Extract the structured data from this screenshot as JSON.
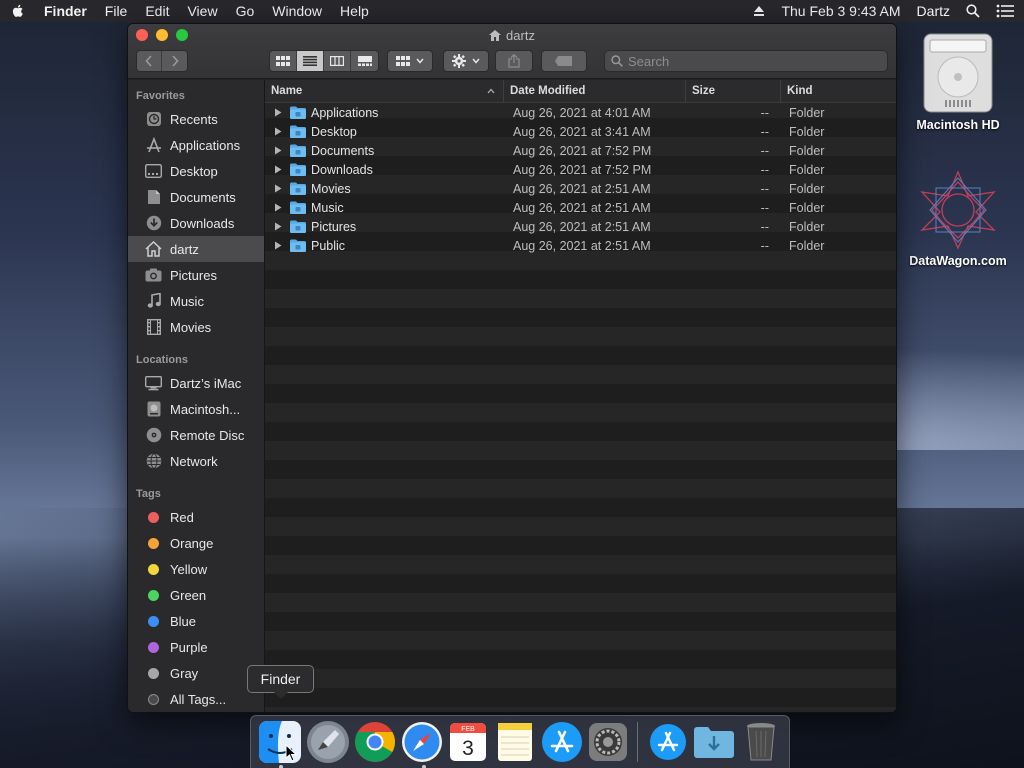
{
  "menubar": {
    "app_name": "Finder",
    "menus": [
      "File",
      "Edit",
      "View",
      "Go",
      "Window",
      "Help"
    ],
    "datetime": "Thu Feb 3  9:43 AM",
    "user": "Dartz"
  },
  "window": {
    "title": "dartz",
    "search_placeholder": "Search"
  },
  "sidebar": {
    "favorites_header": "Favorites",
    "favorites": [
      {
        "label": "Recents",
        "icon": "clock-icon"
      },
      {
        "label": "Applications",
        "icon": "applications-icon"
      },
      {
        "label": "Desktop",
        "icon": "desktop-icon"
      },
      {
        "label": "Documents",
        "icon": "document-icon"
      },
      {
        "label": "Downloads",
        "icon": "download-icon"
      },
      {
        "label": "dartz",
        "icon": "home-icon"
      },
      {
        "label": "Pictures",
        "icon": "camera-icon"
      },
      {
        "label": "Music",
        "icon": "music-note-icon"
      },
      {
        "label": "Movies",
        "icon": "film-icon"
      }
    ],
    "locations_header": "Locations",
    "locations": [
      {
        "label": "Dartz’s iMac",
        "icon": "monitor-icon"
      },
      {
        "label": "Macintosh...",
        "icon": "hard-disk-icon"
      },
      {
        "label": "Remote Disc",
        "icon": "disc-icon"
      },
      {
        "label": "Network",
        "icon": "globe-icon"
      }
    ],
    "tags_header": "Tags",
    "tags": [
      {
        "label": "Red",
        "color": "#ec5f5f"
      },
      {
        "label": "Orange",
        "color": "#f5a33a"
      },
      {
        "label": "Yellow",
        "color": "#f3d53c"
      },
      {
        "label": "Green",
        "color": "#4cd461"
      },
      {
        "label": "Blue",
        "color": "#3a8ef5"
      },
      {
        "label": "Purple",
        "color": "#b163e0"
      },
      {
        "label": "Gray",
        "color": "#a7a7a7"
      }
    ],
    "all_tags": "All Tags..."
  },
  "columns": {
    "name": "Name",
    "date": "Date Modified",
    "size": "Size",
    "kind": "Kind"
  },
  "files": [
    {
      "name": "Applications",
      "date": "Aug 26, 2021 at 4:01 AM",
      "size": "--",
      "kind": "Folder"
    },
    {
      "name": "Desktop",
      "date": "Aug 26, 2021 at 3:41 AM",
      "size": "--",
      "kind": "Folder"
    },
    {
      "name": "Documents",
      "date": "Aug 26, 2021 at 7:52 PM",
      "size": "--",
      "kind": "Folder"
    },
    {
      "name": "Downloads",
      "date": "Aug 26, 2021 at 7:52 PM",
      "size": "--",
      "kind": "Folder"
    },
    {
      "name": "Movies",
      "date": "Aug 26, 2021 at 2:51 AM",
      "size": "--",
      "kind": "Folder"
    },
    {
      "name": "Music",
      "date": "Aug 26, 2021 at 2:51 AM",
      "size": "--",
      "kind": "Folder"
    },
    {
      "name": "Pictures",
      "date": "Aug 26, 2021 at 2:51 AM",
      "size": "--",
      "kind": "Folder"
    },
    {
      "name": "Public",
      "date": "Aug 26, 2021 at 2:51 AM",
      "size": "--",
      "kind": "Folder"
    }
  ],
  "desktop": {
    "icons": [
      {
        "label": "Macintosh HD",
        "icon": "hard-drive-icon"
      },
      {
        "label": "DataWagon.com",
        "icon": "geometric-star-icon"
      }
    ]
  },
  "dock": {
    "tooltip": "Finder",
    "apps": [
      "finder-icon",
      "launchpad-icon",
      "chrome-icon",
      "safari-icon",
      "calendar-icon",
      "notes-icon",
      "app-store-icon",
      "system-preferences-icon"
    ],
    "calendar_month": "FEB",
    "calendar_day": "3",
    "right": [
      "app-store-folder-icon",
      "downloads-folder-icon",
      "trash-icon"
    ]
  }
}
